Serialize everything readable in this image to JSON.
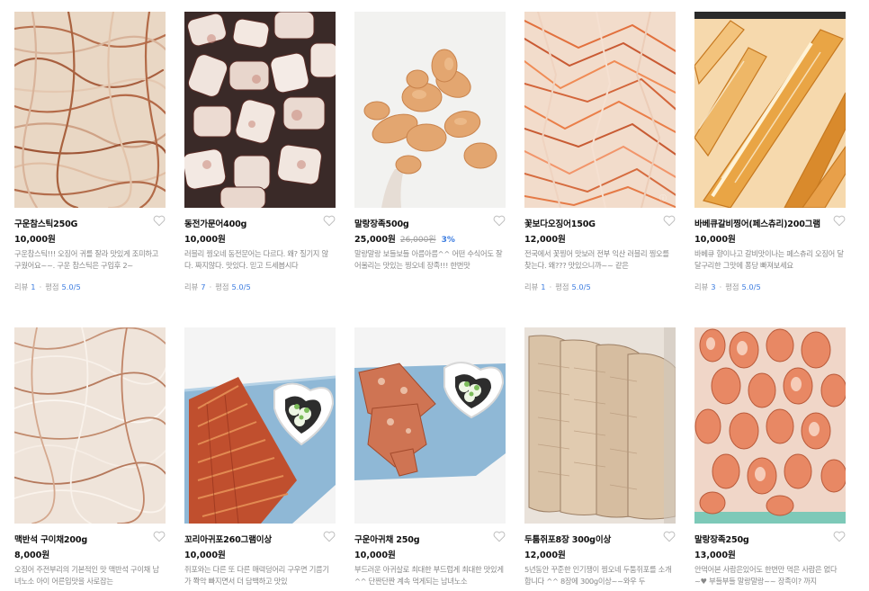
{
  "products": [
    {
      "name": "구운참스틱250G",
      "price": "10,000원",
      "orig_price": "",
      "discount": "",
      "desc": "구운참스틱!!! 오징어 귀를 잘라 맛있게 조미하고 구웠어요~~. 구운 참스틱은 구입후 2~",
      "review_label": "리뷰",
      "review_count": "1",
      "rating_label": "평점",
      "rating": "5.0/5",
      "image": "squid-strips-photo"
    },
    {
      "name": "동전가문어400g",
      "price": "10,000원",
      "orig_price": "",
      "discount": "",
      "desc": "러블리 찡오네 동전문어는 다르다. 왜? 질기지 않다. 짜지않다. 맛있다. 믿고 드세봅시다",
      "review_label": "리뷰",
      "review_count": "7",
      "rating_label": "평점",
      "rating": "5.0/5",
      "image": "octopus-slices-photo"
    },
    {
      "name": "말랑장족500g",
      "price": "25,000원",
      "orig_price": "26,000원",
      "discount": "3%",
      "desc": "말랑말랑 보들보들 아름아름^^ 어떤 수식어도 잘어울리는 맛있는 찡오네 장족!!! 한번맛",
      "review_label": "",
      "review_count": "",
      "rating_label": "",
      "rating": "",
      "image": "dried-squid-legs-photo"
    },
    {
      "name": "꽃보다오징어150G",
      "price": "12,000원",
      "orig_price": "",
      "discount": "",
      "desc": "전국에서 꽃찡어 맛보러 전부 익산 러블리 찡오를 찾는다. 왜??? 맛있으니까~~ 같은",
      "review_label": "리뷰",
      "review_count": "1",
      "rating_label": "평점",
      "rating": "5.0/5",
      "image": "red-squid-shreds-photo"
    },
    {
      "name": "바베큐갈비찡어(페스츄리)200그램",
      "price": "10,000원",
      "orig_price": "",
      "discount": "",
      "desc": "바베큐 향이나고 갈비맛이나는 페스츄리 오징어 달달구리한 그맛에 퐁당 빠져보세요",
      "review_label": "리뷰",
      "review_count": "3",
      "rating_label": "평점",
      "rating": "5.0/5",
      "image": "bbq-squid-pastry-photo"
    },
    {
      "name": "맥반석 구이채200g",
      "price": "8,000원",
      "orig_price": "",
      "discount": "",
      "desc": "오징어 주전부리의 기본적인 맛 맥반석 구이채 남녀노소 아이 어른입맛을 사로잡는",
      "review_label": "",
      "review_count": "",
      "rating_label": "",
      "rating": "",
      "image": "grilled-squid-shreds-photo"
    },
    {
      "name": "꼬리아귀포260그램이상",
      "price": "10,000원",
      "orig_price": "",
      "discount": "",
      "desc": "쥐포와는 다른 또 다른 매력덩어리 구우면 기름기가 쫙악 빠지면서 더 담백하고 맛있",
      "review_label": "",
      "review_count": "",
      "rating_label": "",
      "rating": "",
      "image": "anglerfish-jerky-photo"
    },
    {
      "name": "구운아귀채 250g",
      "price": "10,000원",
      "orig_price": "",
      "discount": "",
      "desc": "부드러운 아귀살로 최대한 부드럽게 최대한 맛있게^^ 단짠단짠 계속 먹게되는 남녀노소",
      "review_label": "",
      "review_count": "",
      "rating_label": "",
      "rating": "",
      "image": "grilled-anglerfish-photo"
    },
    {
      "name": "두툼쥐포8장 300g이상",
      "price": "12,000원",
      "orig_price": "",
      "discount": "",
      "desc": "5년동안 꾸준한 인기쟁이 찡오네 두툼쥐포를 소개합니다 ^^ 8장에 300g이상~~와우 두",
      "review_label": "",
      "review_count": "",
      "rating_label": "",
      "rating": "",
      "image": "filefish-jerky-photo"
    },
    {
      "name": "말랑장족250g",
      "price": "13,000원",
      "orig_price": "",
      "discount": "",
      "desc": "안먹어본 사람은있어도 한번만 먹은 사람은 없다~♥ 부들부들 말랑말랑~~ 장족이? 까지",
      "review_label": "",
      "review_count": "",
      "rating_label": "",
      "rating": "",
      "image": "squid-legs-pile-photo"
    }
  ],
  "colors": {
    "accent": "#3d7de0",
    "text": "#111111",
    "muted": "#888888"
  }
}
